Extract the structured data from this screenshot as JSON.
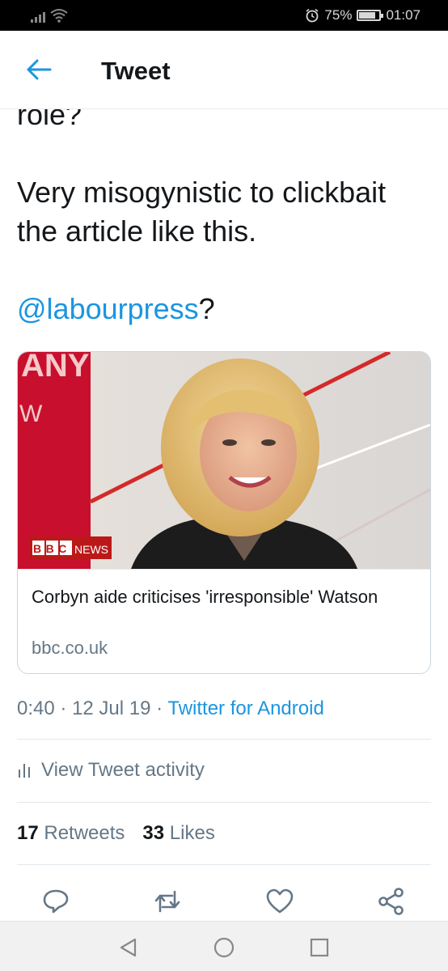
{
  "status_bar": {
    "battery": "75%",
    "time": "01:07",
    "battery_level": 0.75
  },
  "header": {
    "title": "Tweet"
  },
  "tweet": {
    "clipped_text": "role?",
    "text": "Very misogynistic to clickbait the article like this.",
    "mention": "@labourpress",
    "mention_suffix": "?"
  },
  "card": {
    "image_badge_bbc": "BBC",
    "image_badge_news": "NEWS",
    "background_text_top": "ANY",
    "background_text_mid": "W",
    "title": "Corbyn aide criticises 'irresponsible' Watson",
    "domain": "bbc.co.uk"
  },
  "meta": {
    "time": "0:40",
    "separator": "·",
    "date": "12 Jul 19",
    "client": "Twitter for Android"
  },
  "activity": {
    "label": "View Tweet activity"
  },
  "stats": {
    "retweets_count": "17",
    "retweets_label": "Retweets",
    "likes_count": "33",
    "likes_label": "Likes"
  },
  "colors": {
    "accent": "#1b95e0",
    "muted": "#657786",
    "text": "#14171a",
    "bbc_red": "#bb1919"
  },
  "icons": {
    "back": "arrow-left-icon",
    "reply": "reply-icon",
    "retweet": "retweet-icon",
    "like": "heart-icon",
    "share": "share-icon",
    "activity": "bar-chart-icon"
  }
}
